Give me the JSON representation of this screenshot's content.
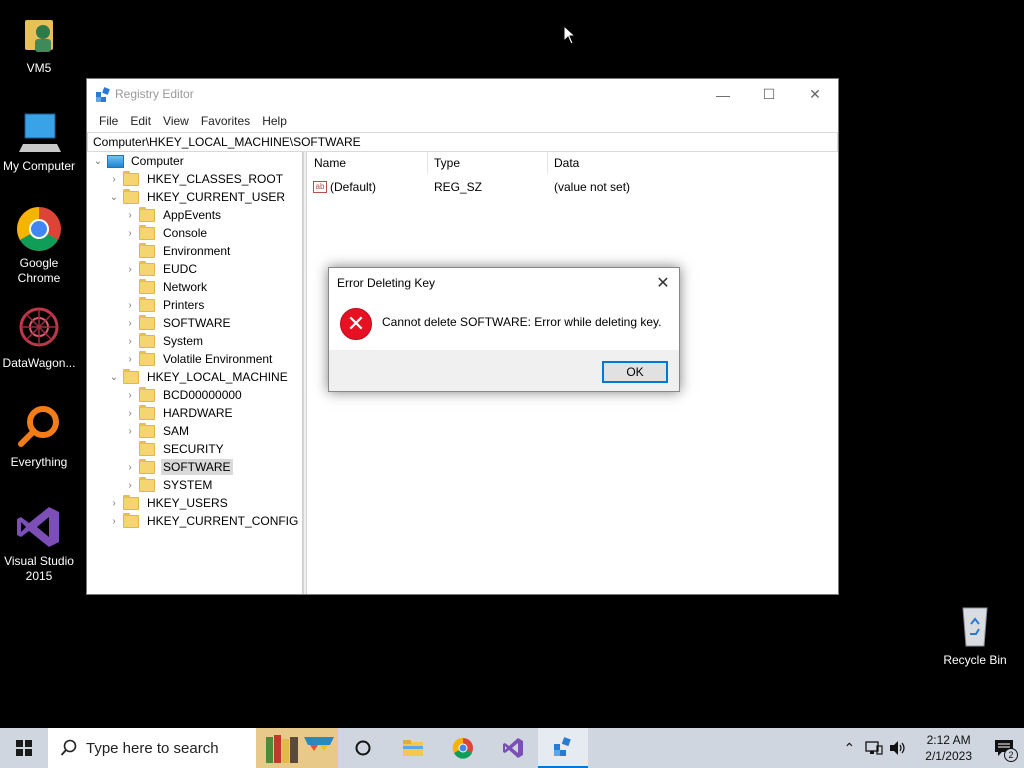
{
  "desktop": {
    "icons": [
      {
        "label": "VM5"
      },
      {
        "label": "My Computer"
      },
      {
        "label": "Google Chrome"
      },
      {
        "label": "DataWagon..."
      },
      {
        "label": "Everything"
      },
      {
        "label": "Visual Studio 2015"
      },
      {
        "label": "Recycle Bin"
      }
    ]
  },
  "window": {
    "title": "Registry Editor",
    "menu": [
      "File",
      "Edit",
      "View",
      "Favorites",
      "Help"
    ],
    "address": "Computer\\HKEY_LOCAL_MACHINE\\SOFTWARE",
    "tree": [
      {
        "label": "Computer"
      },
      {
        "label": "HKEY_CLASSES_ROOT"
      },
      {
        "label": "HKEY_CURRENT_USER"
      },
      {
        "label": "AppEvents"
      },
      {
        "label": "Console"
      },
      {
        "label": "Environment"
      },
      {
        "label": "EUDC"
      },
      {
        "label": "Network"
      },
      {
        "label": "Printers"
      },
      {
        "label": "SOFTWARE"
      },
      {
        "label": "System"
      },
      {
        "label": "Volatile Environment"
      },
      {
        "label": "HKEY_LOCAL_MACHINE"
      },
      {
        "label": "BCD00000000"
      },
      {
        "label": "HARDWARE"
      },
      {
        "label": "SAM"
      },
      {
        "label": "SECURITY"
      },
      {
        "label": "SOFTWARE"
      },
      {
        "label": "SYSTEM"
      },
      {
        "label": "HKEY_USERS"
      },
      {
        "label": "HKEY_CURRENT_CONFIG"
      }
    ],
    "columns": [
      "Name",
      "Type",
      "Data"
    ],
    "values": [
      {
        "name": "(Default)",
        "type": "REG_SZ",
        "data": "(value not set)"
      }
    ]
  },
  "dialog": {
    "title": "Error Deleting Key",
    "message": "Cannot delete SOFTWARE:  Error while deleting key.",
    "ok_label": "OK"
  },
  "taskbar": {
    "search_placeholder": "Type here to search",
    "time": "2:12 AM",
    "date": "2/1/2023",
    "notification_count": "2"
  },
  "colors": {
    "accent": "#0078d7",
    "error": "#e81123",
    "folder": "#f7d472"
  }
}
